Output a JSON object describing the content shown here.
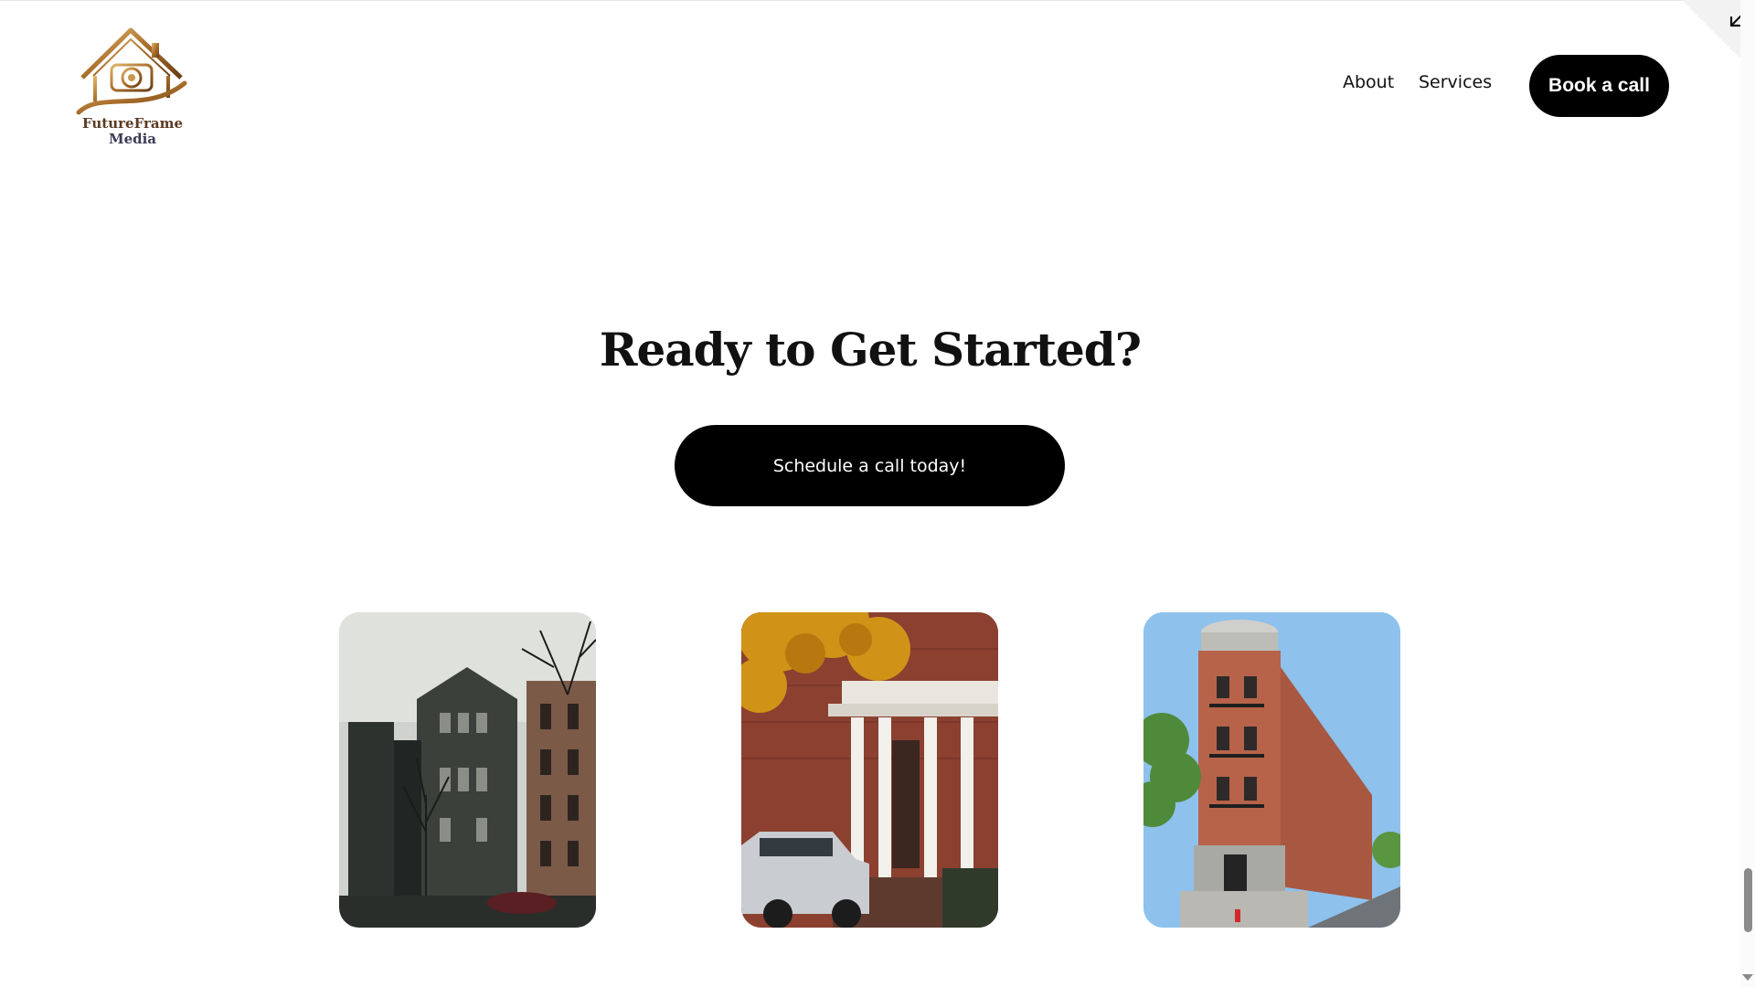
{
  "header": {
    "logo": {
      "line1": "FutureFrame",
      "line2": "Media",
      "icon": "house-camera-logo-icon",
      "colors": {
        "gold": "#b8863b",
        "brown": "#5a3a22"
      }
    },
    "nav": [
      {
        "label": "About"
      },
      {
        "label": "Services"
      }
    ],
    "cta_label": "Book a call"
  },
  "hero": {
    "title": "Ready to Get Started?",
    "cta_label": "Schedule a call today!"
  },
  "gallery": [
    {
      "subject": "brownstone row houses with bare trees"
    },
    {
      "subject": "red brick townhouse with white columns, autumn leaves and parked car"
    },
    {
      "subject": "corner brick building with turret under blue sky"
    }
  ],
  "corner_control": {
    "icon": "arrow-down-left-icon"
  },
  "colors": {
    "button_bg": "#000000",
    "button_text": "#ffffff",
    "background": "#ffffff"
  }
}
